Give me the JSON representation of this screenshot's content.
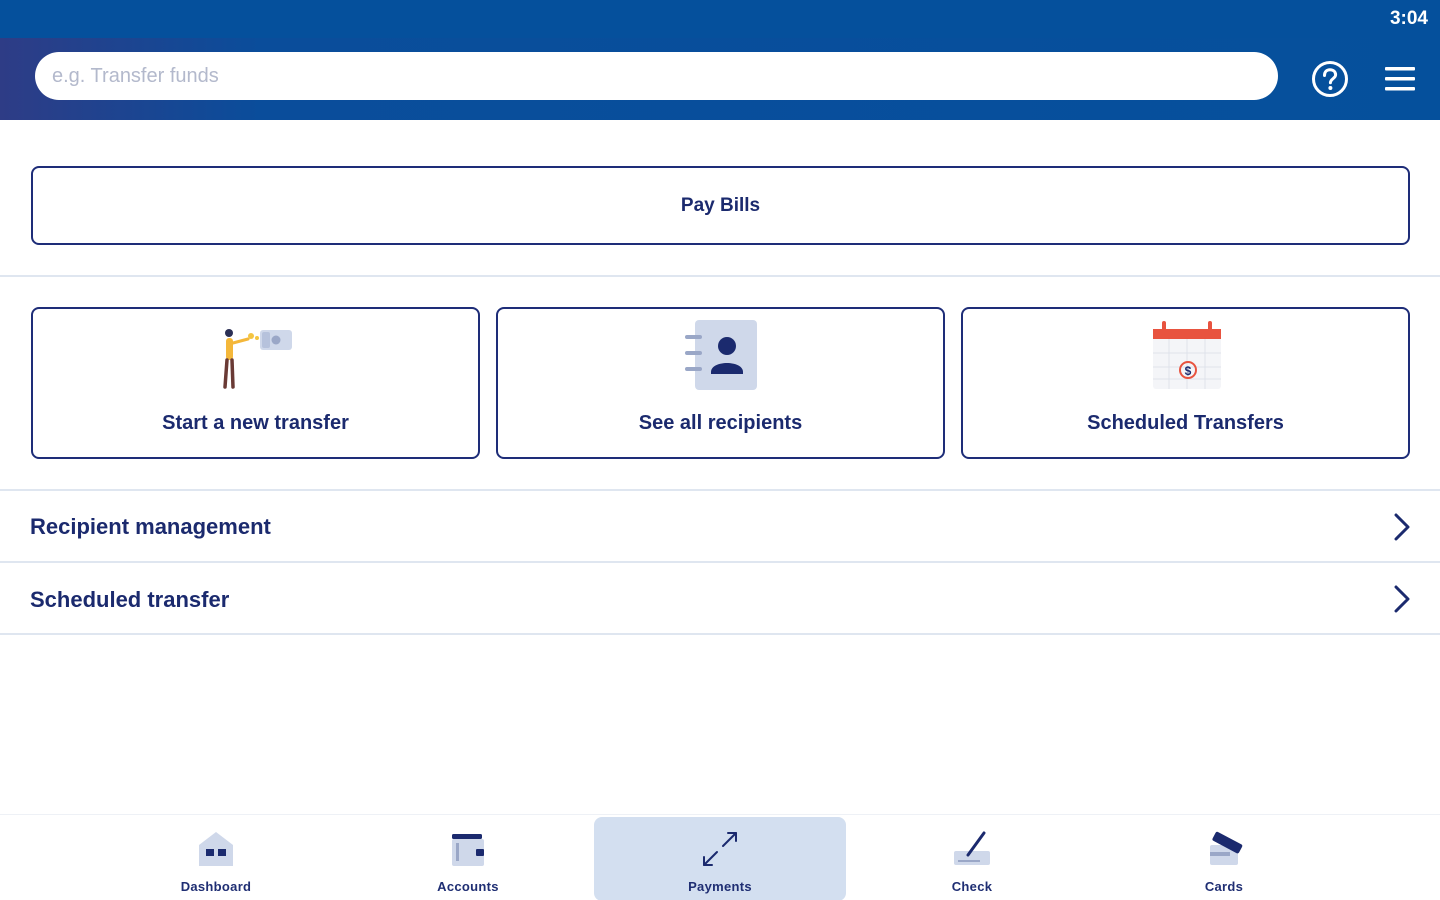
{
  "status_bar": {
    "time": "3:04"
  },
  "search": {
    "placeholder": "e.g. Transfer funds"
  },
  "header": {
    "help_icon": "question-circle-icon",
    "menu_icon": "hamburger-icon"
  },
  "pay_bills": {
    "label": "Pay Bills"
  },
  "tiles": [
    {
      "label": "Start a new transfer",
      "icon": "person-transfer-illustration"
    },
    {
      "label": "See all recipients",
      "icon": "contacts-book-illustration"
    },
    {
      "label": "Scheduled Transfers",
      "icon": "calendar-dollar-illustration"
    }
  ],
  "list": [
    {
      "label": "Recipient management",
      "icon": "chevron-right-icon"
    },
    {
      "label": "Scheduled transfer",
      "icon": "chevron-right-icon"
    }
  ],
  "bottom_nav": [
    {
      "label": "Dashboard",
      "icon": "house-icon",
      "active": false
    },
    {
      "label": "Accounts",
      "icon": "wallet-icon",
      "active": false
    },
    {
      "label": "Payments",
      "icon": "transfer-arrows-icon",
      "active": true
    },
    {
      "label": "Check",
      "icon": "check-pen-icon",
      "active": false
    },
    {
      "label": "Cards",
      "icon": "cards-icon",
      "active": false
    }
  ],
  "colors": {
    "brand_blue": "#05509c",
    "navy": "#1b2a6e",
    "active_nav": "#d3dff0",
    "accent_red": "#e8533f"
  }
}
